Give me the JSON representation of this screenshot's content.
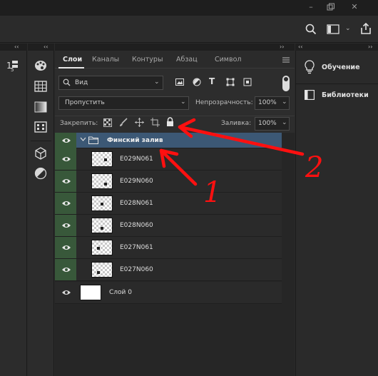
{
  "window": {
    "controls": [
      "minimize-icon",
      "restore-icon",
      "close-icon"
    ]
  },
  "options_bar": {
    "icons": [
      "search-icon",
      "workspace-icon",
      "chevron-down-icon",
      "share-icon"
    ]
  },
  "panel": {
    "tabs": [
      {
        "label": "Слои",
        "active": true
      },
      {
        "label": "Каналы",
        "active": false
      },
      {
        "label": "Контуры",
        "active": false
      },
      {
        "label": "Абзац",
        "active": false
      },
      {
        "label": "Символ",
        "active": false
      }
    ],
    "filter": {
      "value": "Вид"
    },
    "blend_mode": {
      "value": "Пропустить"
    },
    "opacity": {
      "label": "Непрозрачность:",
      "value": "100%"
    },
    "lock": {
      "label": "Закрепить:"
    },
    "fill": {
      "label": "Заливка:",
      "value": "100%"
    },
    "group": {
      "name": "Финский залив"
    },
    "layers": [
      {
        "name": "E029N061"
      },
      {
        "name": "E029N060"
      },
      {
        "name": "E028N061"
      },
      {
        "name": "E028N060"
      },
      {
        "name": "E027N061"
      },
      {
        "name": "E027N060"
      }
    ],
    "bottom_layer": {
      "name": "Слой 0"
    }
  },
  "right_dock": {
    "items": [
      {
        "label": "Обучение"
      },
      {
        "label": "Библиотеки"
      }
    ]
  },
  "annotations": {
    "label_1": "1",
    "label_2": "2",
    "color": "#ff1010"
  }
}
